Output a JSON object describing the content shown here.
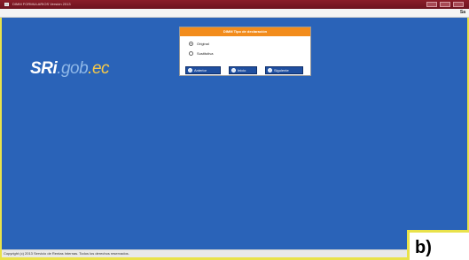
{
  "window": {
    "title": "DIMM FORMULARIOS Versión 2013"
  },
  "menubar": {
    "right_item": "Sa"
  },
  "logo": {
    "part1": "SRi",
    "part2": ".gob",
    "part3": ".ec"
  },
  "dialog": {
    "header": "DIMM Tipo de declaración",
    "options": [
      {
        "label": "Original",
        "selected": true
      },
      {
        "label": "Sustitutiva",
        "selected": false
      }
    ],
    "buttons": {
      "prev": "Anterior",
      "home": "Inicio",
      "next": "Siguiente"
    }
  },
  "status": {
    "copyright": "Copyright (c) 2013 Servicio de Rentas Internas. Todos los derechos reservados."
  },
  "corner_label": "b)"
}
